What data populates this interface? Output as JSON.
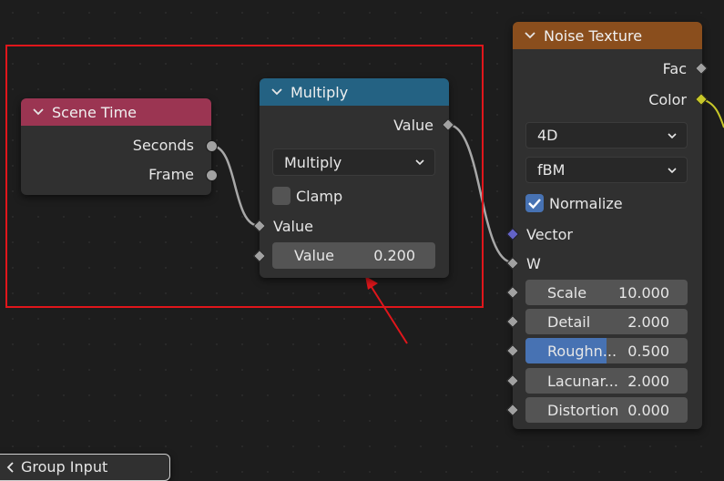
{
  "colors": {
    "scene_time_header": "#9b3552",
    "multiply_header": "#246283",
    "noise_header": "#8a4e1d",
    "highlight_box": "#e0161b",
    "annotation_arrow": "#e0161b",
    "color_socket": "#c7c729",
    "vector_socket": "#6363c7",
    "link": "#a8a8a8",
    "slider_fill": "#4772b3"
  },
  "scene_time": {
    "title": "Scene Time",
    "outputs": [
      "Seconds",
      "Frame"
    ]
  },
  "multiply": {
    "title": "Multiply",
    "output": "Value",
    "operation": "Multiply",
    "clamp_label": "Clamp",
    "clamp_checked": false,
    "input_label": "Value",
    "field_label": "Value",
    "field_value": "0.200"
  },
  "noise": {
    "title": "Noise Texture",
    "outputs": [
      "Fac",
      "Color"
    ],
    "dimensions": "4D",
    "type": "fBM",
    "normalize_label": "Normalize",
    "normalize_checked": true,
    "vector_label": "Vector",
    "w_label": "W",
    "fields": [
      {
        "label": "Scale",
        "value": "10.000"
      },
      {
        "label": "Detail",
        "value": "2.000"
      },
      {
        "label": "Roughn...",
        "value": "0.500",
        "fill": 0.5
      },
      {
        "label": "Lacunar...",
        "value": "2.000"
      },
      {
        "label": "Distortion",
        "value": "0.000"
      }
    ]
  },
  "group_input": {
    "title": "Group Input"
  },
  "icons": {
    "collapse": "chevron-down-icon",
    "dropdown": "chevron-down-icon",
    "check": "checkmark-icon"
  }
}
